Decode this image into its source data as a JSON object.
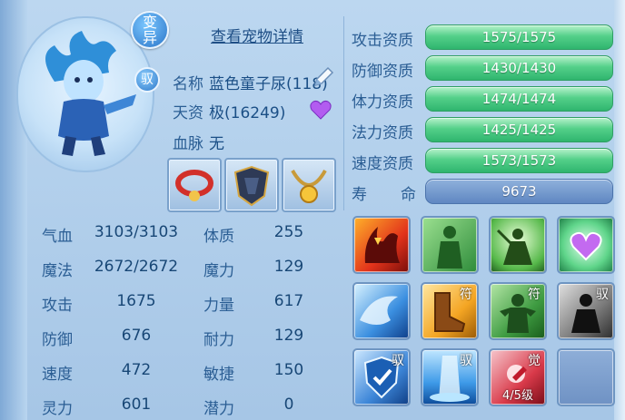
{
  "header": {
    "badge_main": "变异",
    "badge_tag": "驭",
    "view_details_link": "查看宠物详情"
  },
  "info": {
    "name_label": "名称",
    "name_value": "蓝色童子尿(118)",
    "talent_label": "天资",
    "talent_value": "极(16249)",
    "bloodline_label": "血脉",
    "bloodline_value": "无"
  },
  "equipment": [
    {
      "icon": "red-collar-icon"
    },
    {
      "icon": "dark-armor-icon"
    },
    {
      "icon": "gold-necklace-icon"
    }
  ],
  "stats_left": [
    {
      "label": "气血",
      "value": "3103/3103"
    },
    {
      "label": "魔法",
      "value": "2672/2672"
    },
    {
      "label": "攻击",
      "value": "1675"
    },
    {
      "label": "防御",
      "value": "676"
    },
    {
      "label": "速度",
      "value": "472"
    },
    {
      "label": "灵力",
      "value": "601"
    }
  ],
  "stats_right": [
    {
      "label": "体质",
      "value": "255"
    },
    {
      "label": "魔力",
      "value": "129"
    },
    {
      "label": "力量",
      "value": "617"
    },
    {
      "label": "耐力",
      "value": "129"
    },
    {
      "label": "敏捷",
      "value": "150"
    },
    {
      "label": "潜力",
      "value": "0"
    }
  ],
  "aptitudes": [
    {
      "label": "攻击资质",
      "value": "1575/1575",
      "fill": 1.0
    },
    {
      "label": "防御资质",
      "value": "1430/1430",
      "fill": 1.0
    },
    {
      "label": "体力资质",
      "value": "1474/1474",
      "fill": 1.0
    },
    {
      "label": "法力资质",
      "value": "1425/1425",
      "fill": 1.0
    },
    {
      "label": "速度资质",
      "value": "1573/1573",
      "fill": 1.0
    }
  ],
  "lifespan": {
    "label1": "寿",
    "label2": "命",
    "value": "9673"
  },
  "skills": [
    {
      "icon": "fire-demon-skill-icon",
      "tag": ""
    },
    {
      "icon": "green-body-skill-icon",
      "tag": ""
    },
    {
      "icon": "green-warrior-skill-icon",
      "tag": ""
    },
    {
      "icon": "heart-glow-skill-icon",
      "tag": ""
    },
    {
      "icon": "water-wave-skill-icon",
      "tag": ""
    },
    {
      "icon": "boot-skill-icon",
      "tag": "符"
    },
    {
      "icon": "green-strength-skill-icon",
      "tag": "符"
    },
    {
      "icon": "shadow-figure-skill-icon",
      "tag": "驭"
    },
    {
      "icon": "blue-shield-skill-icon",
      "tag": "驭"
    },
    {
      "icon": "ice-pillar-skill-icon",
      "tag": "驭"
    },
    {
      "icon": "red-fist-skill-icon",
      "tag": "觉",
      "level": "4/5级"
    },
    {
      "icon": "empty-slot",
      "tag": ""
    }
  ],
  "colors": {
    "bar_green": "#3fc27a",
    "bar_blue": "#6a8fc8",
    "text": "#1b4f86"
  }
}
